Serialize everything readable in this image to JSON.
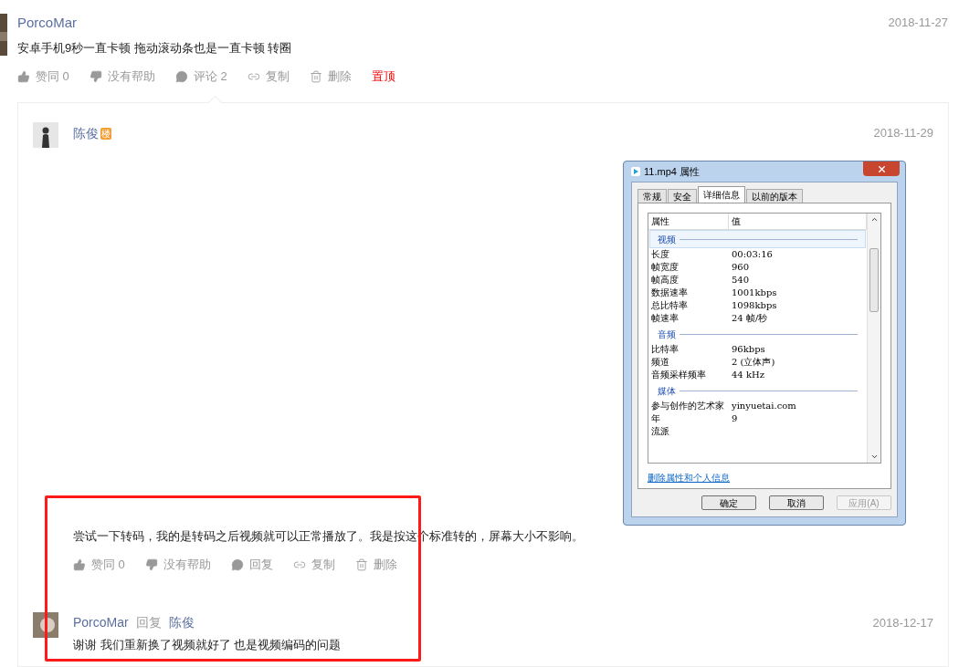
{
  "post": {
    "author": "PorcoMar",
    "text": "安卓手机9秒一直卡顿 拖动滚动条也是一直卡顿 转圈",
    "date": "2018-11-27",
    "actions": [
      {
        "kind": "like",
        "label": "赞同 0"
      },
      {
        "kind": "dislike",
        "label": "没有帮助"
      },
      {
        "kind": "comment",
        "label": "评论 2"
      },
      {
        "kind": "copy",
        "label": "复制"
      },
      {
        "kind": "delete",
        "label": "删除"
      },
      {
        "kind": "pin",
        "label": "置顶"
      }
    ]
  },
  "replies": [
    {
      "author": "陈俊",
      "badge": "楼",
      "date": "2018-11-29",
      "text": "尝试一下转码，我的是转码之后视频就可以正常播放了。我是按这个标准转的，屏幕大小不影响。",
      "attachment": {
        "title": "11.mp4 属性",
        "tabs": [
          {
            "label": "常规",
            "selected": false
          },
          {
            "label": "安全",
            "selected": false
          },
          {
            "label": "详细信息",
            "selected": true
          },
          {
            "label": "以前的版本",
            "selected": false
          }
        ],
        "columns": [
          "属性",
          "值"
        ],
        "groups": [
          {
            "name": "视频",
            "selected": true,
            "rows": [
              [
                "长度",
                "00:03:16"
              ],
              [
                "帧宽度",
                "960"
              ],
              [
                "帧高度",
                "540"
              ],
              [
                "数据速率",
                "1001kbps"
              ],
              [
                "总比特率",
                "1098kbps"
              ],
              [
                "帧速率",
                "24 帧/秒"
              ]
            ]
          },
          {
            "name": "音频",
            "selected": false,
            "rows": [
              [
                "比特率",
                "96kbps"
              ],
              [
                "频道",
                "2 (立体声)"
              ],
              [
                "音频采样频率",
                "44 kHz"
              ]
            ]
          },
          {
            "name": "媒体",
            "selected": false,
            "rows": [
              [
                "参与创作的艺术家",
                "yinyuetai.com"
              ],
              [
                "年",
                "9"
              ],
              [
                "流派",
                ""
              ]
            ]
          }
        ],
        "link": "删除属性和个人信息",
        "buttons": [
          {
            "label": "确定",
            "disabled": false
          },
          {
            "label": "取消",
            "disabled": false
          },
          {
            "label": "应用(A)",
            "disabled": true
          }
        ]
      },
      "actions": [
        {
          "kind": "like",
          "label": "赞同 0"
        },
        {
          "kind": "dislike",
          "label": "没有帮助"
        },
        {
          "kind": "comment",
          "label": "回复"
        },
        {
          "kind": "copy",
          "label": "复制"
        },
        {
          "kind": "delete",
          "label": "删除"
        }
      ]
    },
    {
      "author": "PorcoMar",
      "reply_label": "回复",
      "reply_to": "陈俊",
      "date": "2018-12-17",
      "text": "谢谢 我们重新换了视频就好了 也是视频编码的问题"
    }
  ],
  "annotation": {
    "kind": "rectangle",
    "color": "#ff1a1a"
  }
}
